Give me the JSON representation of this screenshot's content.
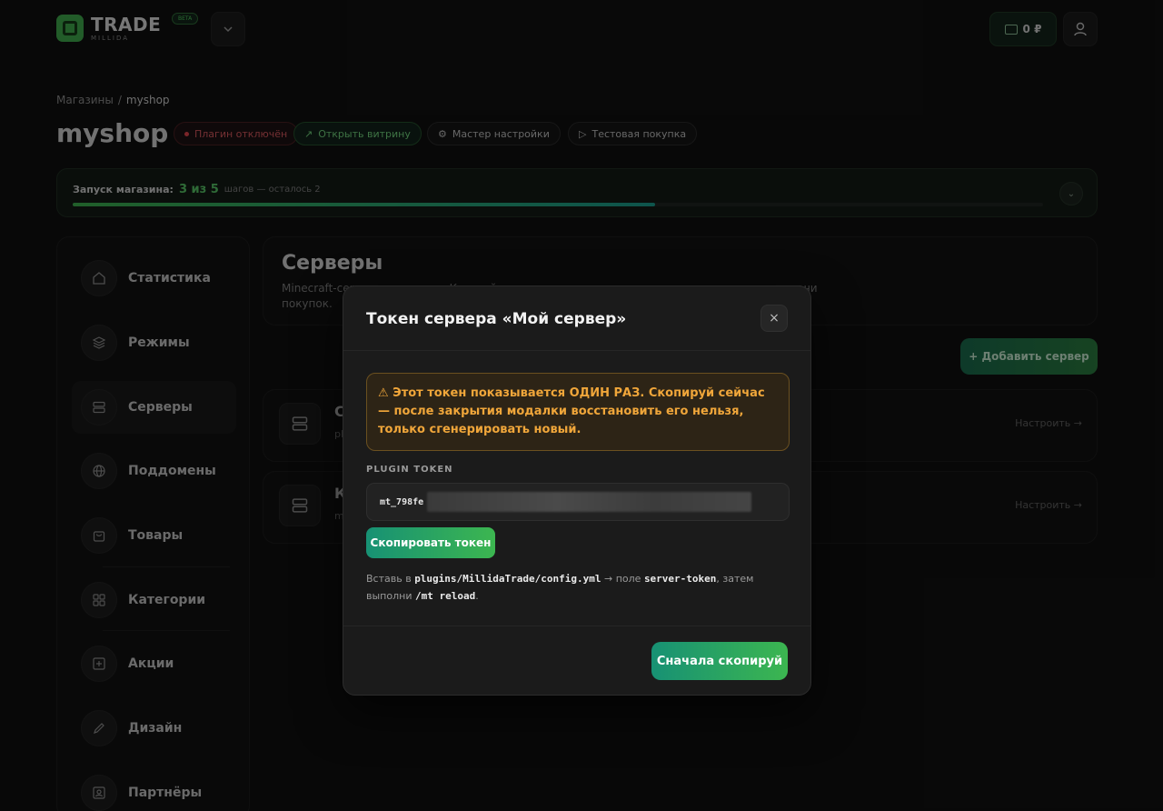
{
  "header": {
    "logo_text": "TRADE",
    "logo_subtext": "MILLIDA",
    "beta_badge": "BETA",
    "wallet_balance": "0 ₽"
  },
  "breadcrumb": {
    "root": "Магазины",
    "separator": "/",
    "current": "myshop"
  },
  "page_title": "myshop",
  "chips": {
    "plugin_status": "Плагин отключён",
    "open_store": "Открыть витрину",
    "setup_wizard": "Мастер настройки",
    "test_purchase": "Тестовая покупка"
  },
  "launch_progress": {
    "label": "Запуск магазина:",
    "count": "3 из 5",
    "rest": "шагов — осталось 2",
    "done": 3,
    "total": 5
  },
  "sidebar": {
    "items": [
      {
        "label": "Статистика",
        "icon": "home-icon"
      },
      {
        "label": "Режимы",
        "icon": "layers-icon"
      },
      {
        "label": "Серверы",
        "icon": "server-icon",
        "active": true
      },
      {
        "label": "Поддомены",
        "icon": "globe-icon"
      },
      {
        "label": "Товары",
        "icon": "bag-icon"
      },
      {
        "label": "Категории",
        "icon": "grid-icon"
      },
      {
        "label": "Акции",
        "icon": "plus-square-icon"
      },
      {
        "label": "Дизайн",
        "icon": "pencil-icon"
      },
      {
        "label": "Партнёры",
        "icon": "contact-icon"
      }
    ]
  },
  "servers": {
    "title": "Серверы",
    "description": "Minecraft-серверы магазина. Каждый подключается плагином и получает токен для выдачи покупок.",
    "add_button": "+ Добавить сервер",
    "rows": [
      {
        "name": "С",
        "sub": "pl",
        "link": "Настроить →"
      },
      {
        "name": "К",
        "sub": "m",
        "link": "Настроить →"
      }
    ]
  },
  "modal": {
    "title": "Токен сервера «Мой сервер»",
    "close": "×",
    "warning": "⚠ Этот токен показывается ОДИН РАЗ. Скопируй сейчас — после закрытия модалки восстановить его нельзя, только сгенерировать новый.",
    "token_label": "PLUGIN TOKEN",
    "token_prefix": "mt_798fe",
    "copy_button": "Скопировать токен",
    "instructions": {
      "part1": "Вставь в ",
      "path": "plugins/MillidaTrade/config.yml",
      "part2": " → поле ",
      "field": "server-token",
      "part3": ", затем выполни ",
      "command": "/mt reload",
      "part4": "."
    },
    "confirm_button": "Сначала скопируй"
  },
  "colors": {
    "accent_green": "#3cb650",
    "accent_teal": "#179174",
    "warning_text": "#f0a63a",
    "danger": "#e0444b"
  }
}
